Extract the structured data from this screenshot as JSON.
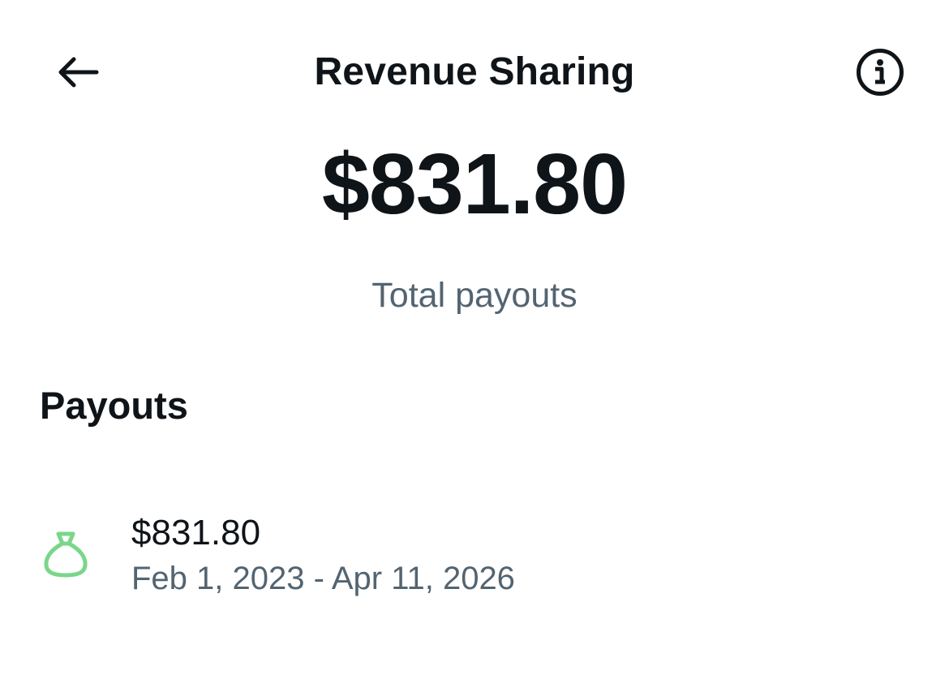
{
  "header": {
    "title": "Revenue Sharing",
    "back_icon": "arrow-left-icon",
    "info_icon": "info-circle-icon"
  },
  "summary": {
    "total_amount": "$831.80",
    "total_label": "Total payouts"
  },
  "payouts": {
    "section_title": "Payouts",
    "items": [
      {
        "icon": "money-bag-icon",
        "icon_color": "#7ad68a",
        "amount": "$831.80",
        "date_range": "Feb 1, 2023 - Apr 11, 2026"
      }
    ]
  },
  "colors": {
    "text_primary": "#0f1419",
    "text_secondary": "#536471",
    "background": "#ffffff"
  }
}
